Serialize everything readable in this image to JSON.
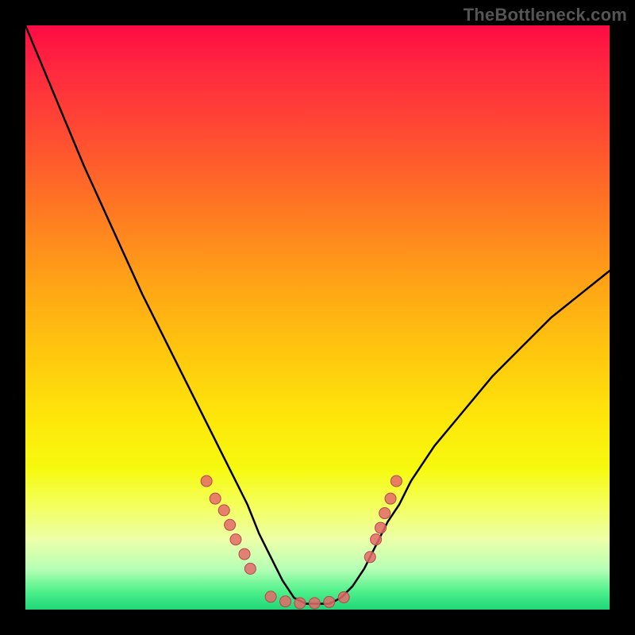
{
  "watermark": "TheBottleneck.com",
  "colors": {
    "frame": "#000000",
    "curve": "#000000",
    "marker_fill": "#e46a6a",
    "marker_stroke": "#b24a4a",
    "gradient_top": "#ff0b44",
    "gradient_bottom": "#1fd677"
  },
  "chart_data": {
    "type": "line",
    "title": "",
    "xlabel": "",
    "ylabel": "",
    "xlim": [
      0,
      100
    ],
    "ylim": [
      0,
      100
    ],
    "grid": false,
    "legend": false,
    "series": [
      {
        "name": "bottleneck-curve",
        "x": [
          0,
          5,
          10,
          15,
          20,
          25,
          30,
          32,
          34,
          36,
          38,
          40,
          42,
          44,
          46,
          48,
          50,
          52,
          54,
          56,
          58,
          60,
          62,
          64,
          66,
          70,
          75,
          80,
          85,
          90,
          95,
          100
        ],
        "values": [
          100,
          88,
          76,
          65,
          54,
          44,
          34,
          30,
          26,
          22,
          18,
          13,
          9,
          5,
          2,
          1,
          1,
          1,
          2,
          4,
          7,
          11,
          15,
          18,
          22,
          28,
          34,
          40,
          45,
          50,
          54,
          58
        ]
      }
    ],
    "markers": [
      {
        "name": "left-cluster",
        "points": [
          {
            "x": 31,
            "y": 22
          },
          {
            "x": 32.5,
            "y": 19
          },
          {
            "x": 34,
            "y": 17
          },
          {
            "x": 35,
            "y": 14.5
          },
          {
            "x": 36,
            "y": 12
          },
          {
            "x": 37.5,
            "y": 9.5
          },
          {
            "x": 38.5,
            "y": 7
          }
        ]
      },
      {
        "name": "bottom-cluster",
        "points": [
          {
            "x": 42,
            "y": 2.2
          },
          {
            "x": 44.5,
            "y": 1.4
          },
          {
            "x": 47,
            "y": 1.1
          },
          {
            "x": 49.5,
            "y": 1.1
          },
          {
            "x": 52,
            "y": 1.3
          },
          {
            "x": 54.5,
            "y": 2.1
          }
        ]
      },
      {
        "name": "right-cluster",
        "points": [
          {
            "x": 59,
            "y": 9
          },
          {
            "x": 60,
            "y": 12
          },
          {
            "x": 60.8,
            "y": 14
          },
          {
            "x": 61.5,
            "y": 16.5
          },
          {
            "x": 62.5,
            "y": 19
          },
          {
            "x": 63.5,
            "y": 22
          }
        ]
      }
    ]
  }
}
